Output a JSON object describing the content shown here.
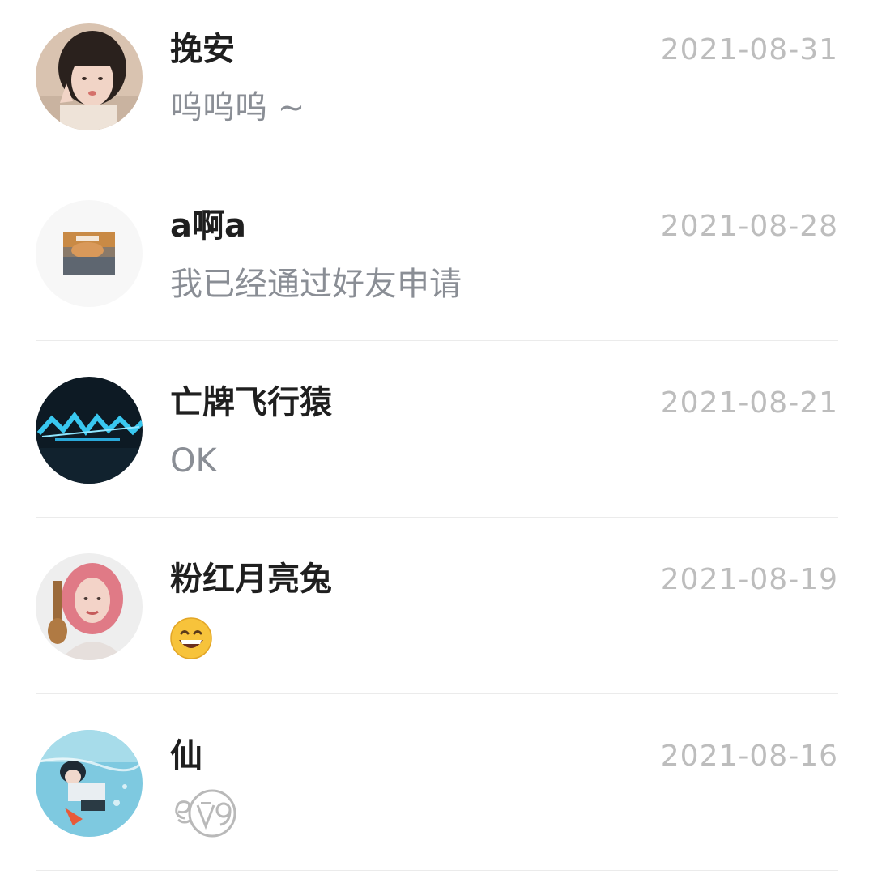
{
  "conversations": [
    {
      "name": "挽安",
      "preview": "呜呜呜 ~",
      "date": "2021-08-31",
      "avatar_icon": "girl-portrait-avatar"
    },
    {
      "name": "a啊a",
      "preview": "我已经通过好友申请",
      "date": "2021-08-28",
      "avatar_icon": "cat-photo-avatar"
    },
    {
      "name": "亡牌飞行猿",
      "preview": "OK",
      "date": "2021-08-21",
      "avatar_icon": "cyberpunk-logo-avatar"
    },
    {
      "name": "粉红月亮兔",
      "preview_icon": "grinning-emoji-icon",
      "date": "2021-08-19",
      "avatar_icon": "pink-hair-girl-avatar"
    },
    {
      "name": "仙",
      "preview_icon": "ev9-sticker-icon",
      "date": "2021-08-16",
      "avatar_icon": "underwater-anime-avatar"
    }
  ],
  "colors": {
    "name": "#1f1f1f",
    "preview": "#8a8e95",
    "date": "#bdbdbd",
    "divider": "#ebebeb"
  }
}
